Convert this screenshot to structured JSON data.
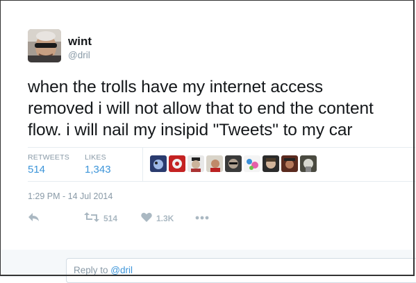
{
  "author": {
    "name": "wint",
    "handle": "@dril"
  },
  "tweet": {
    "text_line1": "when the trolls have my internet access",
    "text_line2": "removed i will not allow that to end the content",
    "text_line3": "flow. i will nail my insipid \"Tweets\" to my car",
    "timestamp": "1:29 PM - 14 Jul 2014"
  },
  "stats": {
    "retweets_label": "RETWEETS",
    "retweets_value": "514",
    "likes_label": "LIKES",
    "likes_value": "1,343"
  },
  "actions": {
    "reply_icon": "reply-icon",
    "retweet_icon": "retweet-icon",
    "retweet_count": "514",
    "like_icon": "heart-icon",
    "like_count": "1.3K",
    "more_icon": "more-icon"
  },
  "reply": {
    "prefix": "Reply to",
    "mention": "@dril"
  },
  "colors": {
    "accent": "#3b94d9",
    "muted": "#8899a6",
    "action_icon": "#aab8c2",
    "divider": "#e6ecf0"
  }
}
